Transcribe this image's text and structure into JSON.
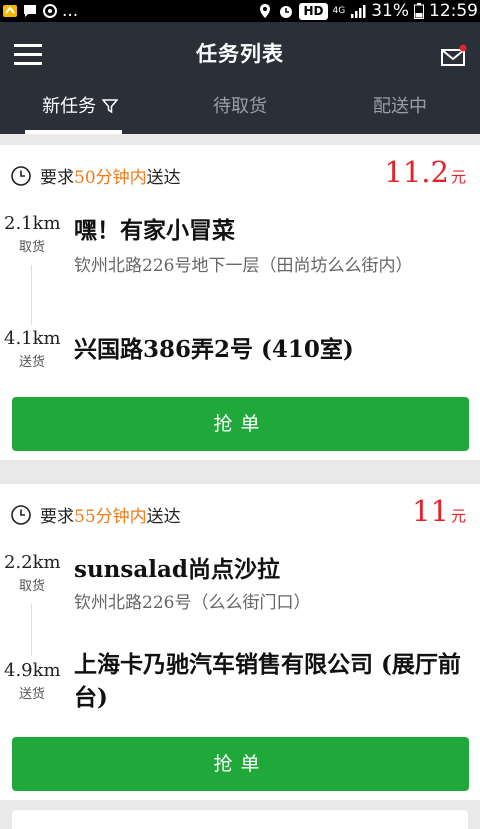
{
  "status_bar": {
    "left_trailing": "...",
    "network_badge": "HD",
    "signal_label": "4G",
    "battery": "31%",
    "time": "12:59"
  },
  "header": {
    "title": "任务列表",
    "menu_icon": "hamburger-menu-icon",
    "mail_icon": "mail-icon",
    "mail_badge_color": "#e3222a"
  },
  "tabs": [
    {
      "label": "新任务",
      "active": true,
      "icon": "filter-icon"
    },
    {
      "label": "待取货",
      "active": false
    },
    {
      "label": "配送中",
      "active": false
    }
  ],
  "tasks": [
    {
      "req_prefix": "要求",
      "req_time": "50分钟内",
      "req_suffix": "送达",
      "price": "11.2",
      "price_unit": "元",
      "pickup_distance": "2.1km",
      "pickup_label": "取货",
      "pickup_name": "嘿！有家小冒菜",
      "pickup_address": "钦州北路226号地下一层（田尚坊么么街内）",
      "delivery_distance": "4.1km",
      "delivery_label": "送货",
      "delivery_address": "兴国路386弄2号 (410室)",
      "button_label": "抢单"
    },
    {
      "req_prefix": "要求",
      "req_time": "55分钟内",
      "req_suffix": "送达",
      "price": "11",
      "price_unit": "元",
      "pickup_distance": "2.2km",
      "pickup_label": "取货",
      "pickup_name": "sunsalad尚点沙拉",
      "pickup_address": "钦州北路226号（么么街门口）",
      "delivery_distance": "4.9km",
      "delivery_label": "送货",
      "delivery_address": "上海卡乃驰汽车销售有限公司 (展厅前台)",
      "button_label": "抢单"
    }
  ],
  "colors": {
    "header_bg": "#2b2f38",
    "accent_orange": "#ef7b1d",
    "price_red": "#e3222a",
    "button_green": "#20a93a"
  }
}
